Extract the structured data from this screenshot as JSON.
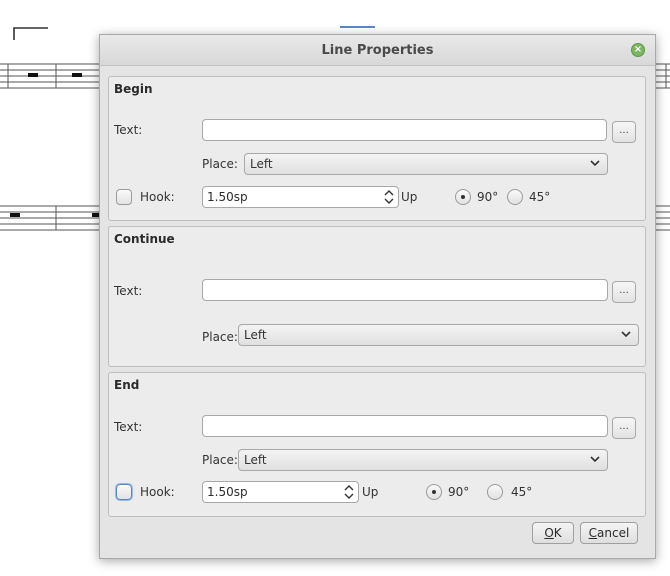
{
  "dialog": {
    "title": "Line Properties"
  },
  "begin": {
    "title": "Begin",
    "text_label": "Text:",
    "text_value": "",
    "dots_label": "...",
    "place_label": "Place:",
    "place_value": "Left",
    "hook_label": "Hook:",
    "hook_checked": false,
    "hook_value": "1.50sp",
    "up_label": "Up",
    "angle_90": "90°",
    "angle_45": "45°",
    "angle_selected": "90°"
  },
  "continue": {
    "title": "Continue",
    "text_label": "Text:",
    "text_value": "",
    "dots_label": "...",
    "place_label": "Place:",
    "place_value": "Left"
  },
  "end": {
    "title": "End",
    "text_label": "Text:",
    "text_value": "",
    "dots_label": "...",
    "place_label": "Place:",
    "place_value": "Left",
    "hook_label": "Hook:",
    "hook_checked": false,
    "hook_value": "1.50sp",
    "up_label": "Up",
    "angle_90": "90°",
    "angle_45": "45°",
    "angle_selected": "90°"
  },
  "buttons": {
    "ok_mnemonic": "O",
    "ok_rest": "K",
    "cancel_mnemonic": "C",
    "cancel_rest": "ancel"
  },
  "colors": {
    "close_button": "#7bb661",
    "selection_accent": "#5b86c5"
  }
}
